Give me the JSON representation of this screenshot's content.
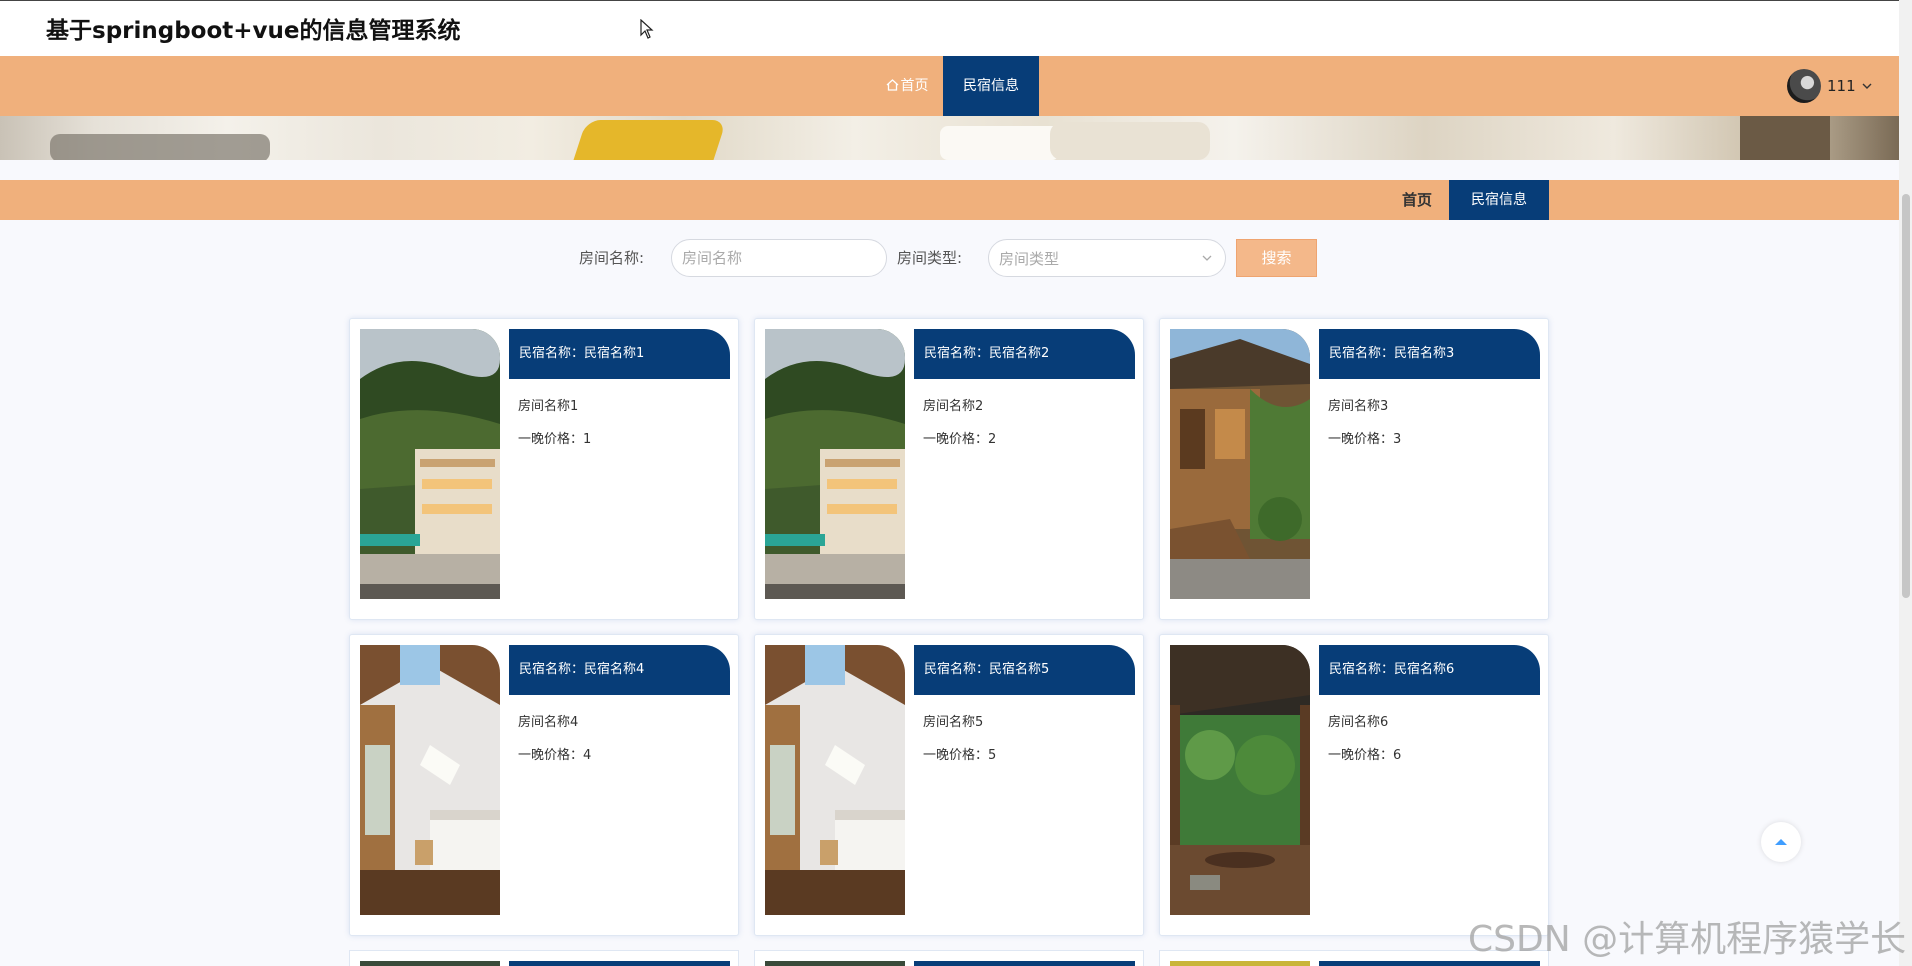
{
  "header": {
    "app_title": "基于springboot+vue的信息管理系统"
  },
  "nav": {
    "home_label": "首页",
    "active_label": "民宿信息",
    "user_name": "111"
  },
  "breadcrumb": {
    "home": "首页",
    "current": "民宿信息"
  },
  "search": {
    "room_name_label": "房间名称:",
    "room_name_placeholder": "房间名称",
    "room_type_label": "房间类型:",
    "room_type_placeholder": "房间类型",
    "button_label": "搜索"
  },
  "cards": [
    {
      "title": "民宿名称：民宿名称1",
      "room": "房间名称1",
      "price": "一晚价格：1",
      "photo": "villa"
    },
    {
      "title": "民宿名称：民宿名称2",
      "room": "房间名称2",
      "price": "一晚价格：2",
      "photo": "villa"
    },
    {
      "title": "民宿名称：民宿名称3",
      "room": "房间名称3",
      "price": "一晚价格：3",
      "photo": "wooden-house"
    },
    {
      "title": "民宿名称：民宿名称4",
      "room": "房间名称4",
      "price": "一晚价格：4",
      "photo": "bedroom"
    },
    {
      "title": "民宿名称：民宿名称5",
      "room": "房间名称5",
      "price": "一晚价格：5",
      "photo": "bedroom"
    },
    {
      "title": "民宿名称：民宿名称6",
      "room": "房间名称6",
      "price": "一晚价格：6",
      "photo": "veranda"
    }
  ],
  "watermark": "CSDN @计算机程序猿学长",
  "colors": {
    "nav_bg": "#f0b07c",
    "accent": "#073d78",
    "search_button": "#f4b88a"
  }
}
